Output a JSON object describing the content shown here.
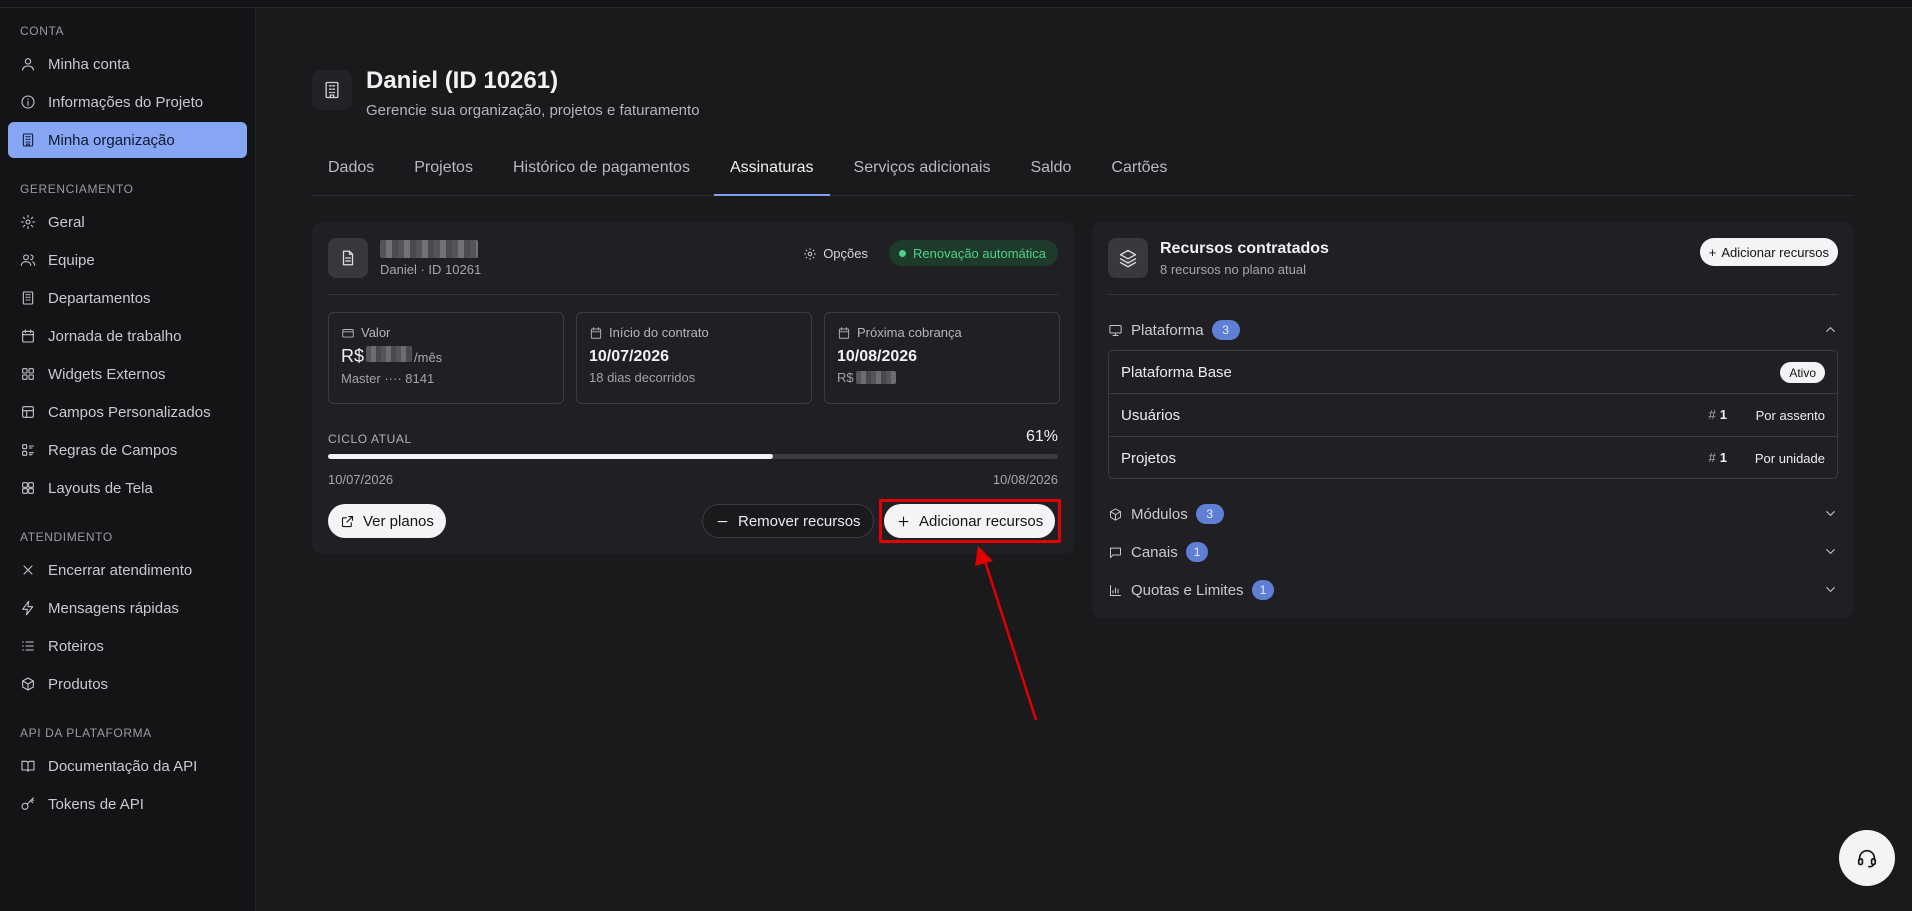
{
  "sidebar": {
    "sections": [
      {
        "title": "CONTA",
        "items": [
          {
            "label": "Minha conta",
            "icon": "user-icon"
          },
          {
            "label": "Informações do Projeto",
            "icon": "info-icon"
          },
          {
            "label": "Minha organização",
            "icon": "building-icon",
            "active": true
          }
        ]
      },
      {
        "title": "GERENCIAMENTO",
        "items": [
          {
            "label": "Geral",
            "icon": "gear-icon"
          },
          {
            "label": "Equipe",
            "icon": "users-icon"
          },
          {
            "label": "Departamentos",
            "icon": "building-icon"
          },
          {
            "label": "Jornada de trabalho",
            "icon": "calendar-icon"
          },
          {
            "label": "Widgets Externos",
            "icon": "grid-icon"
          },
          {
            "label": "Campos Personalizados",
            "icon": "columns-icon"
          },
          {
            "label": "Regras de Campos",
            "icon": "list-rules-icon"
          },
          {
            "label": "Layouts de Tela",
            "icon": "layout-icon"
          }
        ]
      },
      {
        "title": "ATENDIMENTO",
        "items": [
          {
            "label": "Encerrar atendimento",
            "icon": "close-icon"
          },
          {
            "label": "Mensagens rápidas",
            "icon": "bolt-icon"
          },
          {
            "label": "Roteiros",
            "icon": "list-icon"
          },
          {
            "label": "Produtos",
            "icon": "box-icon"
          }
        ]
      },
      {
        "title": "API DA PLATAFORMA",
        "items": [
          {
            "label": "Documentação da API",
            "icon": "book-icon"
          },
          {
            "label": "Tokens de API",
            "icon": "key-icon"
          }
        ]
      }
    ]
  },
  "header": {
    "title": "Daniel (ID 10261)",
    "subtitle": "Gerencie sua organização, projetos e faturamento"
  },
  "tabs": [
    {
      "label": "Dados"
    },
    {
      "label": "Projetos"
    },
    {
      "label": "Histórico de pagamentos"
    },
    {
      "label": "Assinaturas",
      "active": true
    },
    {
      "label": "Serviços adicionais"
    },
    {
      "label": "Saldo"
    },
    {
      "label": "Cartões"
    }
  ],
  "subscription": {
    "meta": "Daniel · ID 10261",
    "options_label": "Opções",
    "auto_renew_label": "Renovação automática",
    "value": {
      "label": "Valor",
      "currency": "R$",
      "suffix": "/mês",
      "card": "Master ···· 8141"
    },
    "start": {
      "label": "Início do contrato",
      "date": "10/07/2026",
      "elapsed": "18 dias decorridos"
    },
    "next": {
      "label": "Próxima cobrança",
      "date": "10/08/2026",
      "amount_prefix": "R$"
    },
    "cycle": {
      "label": "CICLO ATUAL",
      "percent_text": "61%",
      "progress": 0.61,
      "start": "10/07/2026",
      "end": "10/08/2026"
    },
    "buttons": {
      "plans": "Ver planos",
      "remove": "Remover recursos",
      "add": "Adicionar recursos"
    }
  },
  "resources": {
    "title": "Recursos contratados",
    "subtitle": "8 recursos no plano atual",
    "add_label": "Adicionar recursos",
    "platform": {
      "name": "Plataforma",
      "count": "3"
    },
    "rows": [
      {
        "name": "Plataforma Base",
        "badge": "Ativo"
      },
      {
        "name": "Usuários",
        "hash": "#",
        "qty": "1",
        "unit": "Por assento"
      },
      {
        "name": "Projetos",
        "hash": "#",
        "qty": "1",
        "unit": "Por unidade"
      }
    ],
    "groups": [
      {
        "name": "Módulos",
        "count": "3"
      },
      {
        "name": "Canais",
        "count": "1"
      },
      {
        "name": "Quotas e Limites",
        "count": "1"
      }
    ]
  },
  "colors": {
    "accent": "#86a6f3",
    "badge_blue": "#5f7fd6",
    "success": "#4fd08a",
    "highlight": "#e00000"
  }
}
